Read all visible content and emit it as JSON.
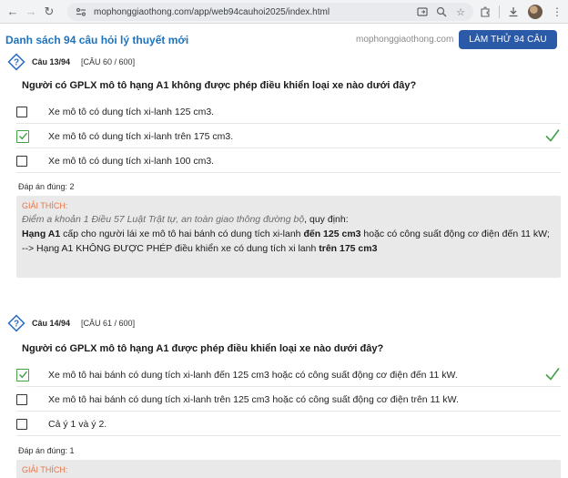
{
  "browser": {
    "url": "mophonggiaothong.com/app/web94cauhoi2025/index.html"
  },
  "header": {
    "title": "Danh sách 94 câu hỏi lý thuyết mới",
    "site": "mophonggiaothong.com",
    "try_button": "LÀM THỬ 94 CÂU"
  },
  "questions": [
    {
      "number": "Câu 13/94",
      "ref": "[CÂU 60 / 600]",
      "text": "Người có GPLX mô tô hạng A1 không được phép điều khiển loại xe nào dưới đây?",
      "options": [
        {
          "text": "Xe mô tô có dung tích xi-lanh 125 cm3.",
          "checked": false
        },
        {
          "text": "Xe mô tô có dung tích xi-lanh trên 175 cm3.",
          "checked": true
        },
        {
          "text": "Xe mô tô có dung tích xi-lanh 100 cm3.",
          "checked": false
        }
      ],
      "answer": "Đáp án đúng:  2",
      "explain_label": "GIẢI THÍCH:",
      "explain": {
        "line1_italic": "Điểm a khoản 1 Điều 57 Luật Trật tự, an toàn giao thông đường bộ",
        "line1_rest": ", quy định:",
        "bold_a1": "Hạng A1",
        "line2_mid": " cấp cho người lái xe mô tô hai bánh có dung tích xi-lanh ",
        "bold_125": "đến 125 cm3",
        "line2_end": " hoặc có công suất động cơ điện đến 11 kW;",
        "line3_start": "--> Hạng A1 KHÔNG ĐƯỢC PHÉP điều khiển xe có dung tích xi lanh ",
        "bold_175": "trên 175 cm3"
      }
    },
    {
      "number": "Câu 14/94",
      "ref": "[CÂU 61 / 600]",
      "text": "Người có GPLX mô tô hạng A1 được phép điều khiển loại xe nào dưới đây?",
      "options": [
        {
          "text": "Xe mô tô hai bánh có dung tích xi-lanh đến 125 cm3 hoặc có công suất động cơ điện đến 11 kW.",
          "checked": true
        },
        {
          "text": "Xe mô tô hai bánh có dung tích xi-lanh trên 125 cm3 hoặc có công suất động cơ điện trên 11 kW.",
          "checked": false
        },
        {
          "text": "Cả ý 1 và ý 2.",
          "checked": false
        }
      ],
      "answer": "Đáp án đúng:  1",
      "explain_label": "GIẢI THÍCH:"
    }
  ],
  "colors": {
    "accent": "#1e73be",
    "button": "#2b5aa8",
    "correct": "#43a047",
    "explain_label": "#e8744a",
    "explain_bg": "#e9e9e9"
  }
}
